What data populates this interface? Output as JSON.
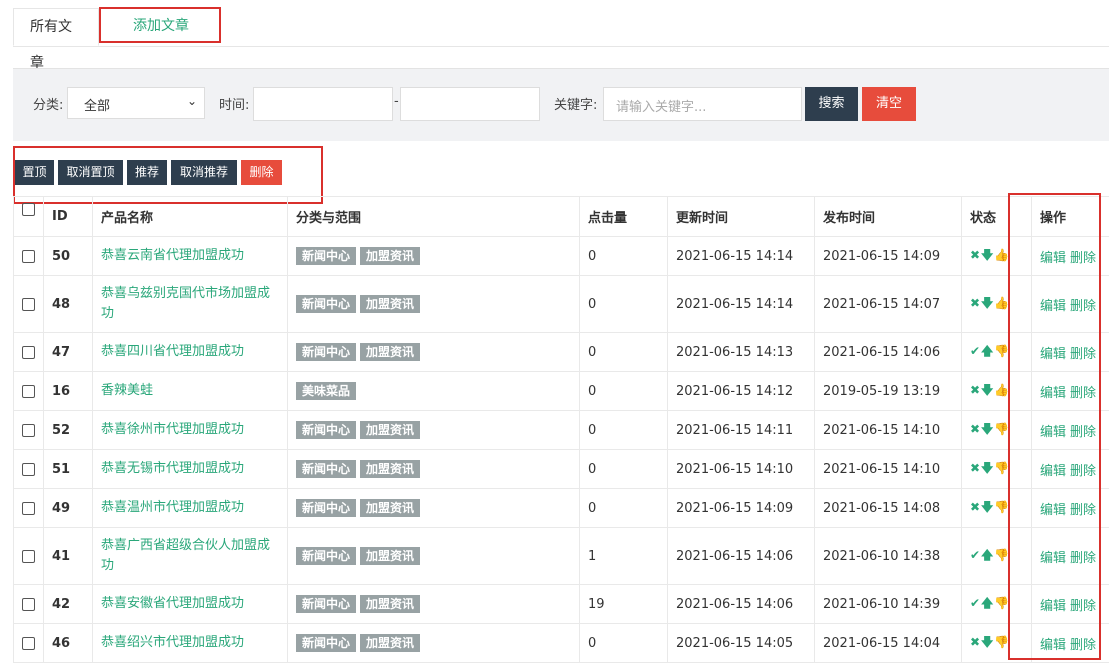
{
  "tabs": {
    "all": "所有文章",
    "add": "添加文章"
  },
  "filter": {
    "category_label": "分类:",
    "category_value": "全部",
    "time_label": "时间:",
    "time_sep": "-",
    "keyword_label": "关键字:",
    "keyword_placeholder": "请输入关键字...",
    "search": "搜索",
    "clear": "清空"
  },
  "batch": [
    "置顶",
    "取消置顶",
    "推荐",
    "取消推荐",
    "删除"
  ],
  "columns": [
    "ID",
    "产品名称",
    "分类与范围",
    "点击量",
    "更新时间",
    "发布时间",
    "状态",
    "操作"
  ],
  "actions": {
    "edit": "编辑",
    "delete": "删除"
  },
  "rows": [
    {
      "id": "50",
      "name": "恭喜云南省代理加盟成功",
      "tags": [
        "新闻中心",
        "加盟资讯"
      ],
      "clicks": "0",
      "updated": "2021-06-15 14:14",
      "published": "2021-06-15 14:09",
      "status": "✖🡇👍"
    },
    {
      "id": "48",
      "name": "恭喜乌兹别克国代市场加盟成功",
      "tags": [
        "新闻中心",
        "加盟资讯"
      ],
      "clicks": "0",
      "updated": "2021-06-15 14:14",
      "published": "2021-06-15 14:07",
      "status": "✖🡇👍"
    },
    {
      "id": "47",
      "name": "恭喜四川省代理加盟成功",
      "tags": [
        "新闻中心",
        "加盟资讯"
      ],
      "clicks": "0",
      "updated": "2021-06-15 14:13",
      "published": "2021-06-15 14:06",
      "status": "✔🡅👎"
    },
    {
      "id": "16",
      "name": "香辣美蛙",
      "tags": [
        "美味菜品"
      ],
      "clicks": "0",
      "updated": "2021-06-15 14:12",
      "published": "2019-05-19 13:19",
      "status": "✖🡇👍"
    },
    {
      "id": "52",
      "name": "恭喜徐州市代理加盟成功",
      "tags": [
        "新闻中心",
        "加盟资讯"
      ],
      "clicks": "0",
      "updated": "2021-06-15 14:11",
      "published": "2021-06-15 14:10",
      "status": "✖🡇👎"
    },
    {
      "id": "51",
      "name": "恭喜无锡市代理加盟成功",
      "tags": [
        "新闻中心",
        "加盟资讯"
      ],
      "clicks": "0",
      "updated": "2021-06-15 14:10",
      "published": "2021-06-15 14:10",
      "status": "✖🡇👎"
    },
    {
      "id": "49",
      "name": "恭喜温州市代理加盟成功",
      "tags": [
        "新闻中心",
        "加盟资讯"
      ],
      "clicks": "0",
      "updated": "2021-06-15 14:09",
      "published": "2021-06-15 14:08",
      "status": "✖🡇👎"
    },
    {
      "id": "41",
      "name": "恭喜广西省超级合伙人加盟成功",
      "tags": [
        "新闻中心",
        "加盟资讯"
      ],
      "clicks": "1",
      "updated": "2021-06-15 14:06",
      "published": "2021-06-10 14:38",
      "status": "✔🡅👎"
    },
    {
      "id": "42",
      "name": "恭喜安徽省代理加盟成功",
      "tags": [
        "新闻中心",
        "加盟资讯"
      ],
      "clicks": "19",
      "updated": "2021-06-15 14:06",
      "published": "2021-06-10 14:39",
      "status": "✔🡅👎"
    },
    {
      "id": "46",
      "name": "恭喜绍兴市代理加盟成功",
      "tags": [
        "新闻中心",
        "加盟资讯"
      ],
      "clicks": "0",
      "updated": "2021-06-15 14:05",
      "published": "2021-06-15 14:04",
      "status": "✖🡇👎"
    }
  ]
}
